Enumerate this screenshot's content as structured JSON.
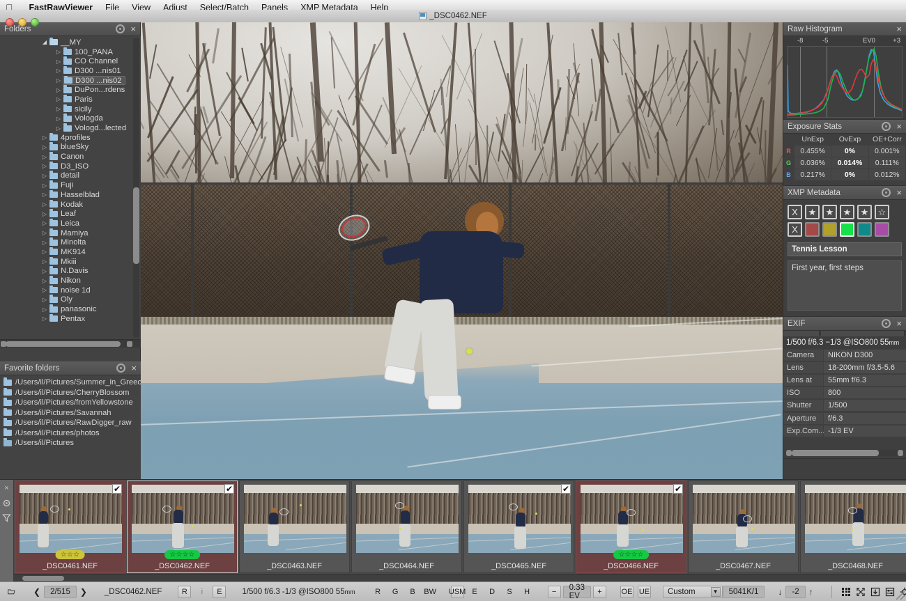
{
  "menubar": {
    "apple": "apple-logo",
    "items": [
      "FastRawViewer",
      "File",
      "View",
      "Adjust",
      "Select/Batch",
      "Panels",
      "XMP Metadata",
      "Help"
    ]
  },
  "window": {
    "title": "_DSC0462.NEF"
  },
  "folders_panel": {
    "title": "Folders",
    "tree": [
      {
        "label": "__MY",
        "depth": 1,
        "twisty": "open",
        "selected": false
      },
      {
        "label": "100_PANA",
        "depth": 2,
        "twisty": "closed",
        "selected": false
      },
      {
        "label": "CO Channel",
        "depth": 2,
        "twisty": "closed",
        "selected": false
      },
      {
        "label": "D300 ...nis01",
        "depth": 2,
        "twisty": "closed",
        "selected": false
      },
      {
        "label": "D300 ...nis02",
        "depth": 2,
        "twisty": "closed",
        "selected": true
      },
      {
        "label": "DuPon...rdens",
        "depth": 2,
        "twisty": "closed",
        "selected": false
      },
      {
        "label": "Paris",
        "depth": 2,
        "twisty": "closed",
        "selected": false
      },
      {
        "label": "sicily",
        "depth": 2,
        "twisty": "closed",
        "selected": false
      },
      {
        "label": "Vologda",
        "depth": 2,
        "twisty": "closed",
        "selected": false
      },
      {
        "label": "Vologd...lected",
        "depth": 2,
        "twisty": "closed",
        "selected": false
      },
      {
        "label": "4profiles",
        "depth": 1,
        "twisty": "closed",
        "selected": false
      },
      {
        "label": "blueSky",
        "depth": 1,
        "twisty": "closed",
        "selected": false
      },
      {
        "label": "Canon",
        "depth": 1,
        "twisty": "closed",
        "selected": false
      },
      {
        "label": "D3_ISO",
        "depth": 1,
        "twisty": "closed",
        "selected": false
      },
      {
        "label": "detail",
        "depth": 1,
        "twisty": "closed",
        "selected": false
      },
      {
        "label": "Fuji",
        "depth": 1,
        "twisty": "closed",
        "selected": false
      },
      {
        "label": "Hasselblad",
        "depth": 1,
        "twisty": "closed",
        "selected": false
      },
      {
        "label": "Kodak",
        "depth": 1,
        "twisty": "closed",
        "selected": false
      },
      {
        "label": "Leaf",
        "depth": 1,
        "twisty": "closed",
        "selected": false
      },
      {
        "label": "Leica",
        "depth": 1,
        "twisty": "closed",
        "selected": false
      },
      {
        "label": "Mamiya",
        "depth": 1,
        "twisty": "closed",
        "selected": false
      },
      {
        "label": "Minolta",
        "depth": 1,
        "twisty": "closed",
        "selected": false
      },
      {
        "label": "MK914",
        "depth": 1,
        "twisty": "closed",
        "selected": false
      },
      {
        "label": "Mkiii",
        "depth": 1,
        "twisty": "closed",
        "selected": false
      },
      {
        "label": "N.Davis",
        "depth": 1,
        "twisty": "closed",
        "selected": false
      },
      {
        "label": "Nikon",
        "depth": 1,
        "twisty": "closed",
        "selected": false
      },
      {
        "label": "noise 1d",
        "depth": 1,
        "twisty": "closed",
        "selected": false
      },
      {
        "label": "Oly",
        "depth": 1,
        "twisty": "closed",
        "selected": false
      },
      {
        "label": "panasonic",
        "depth": 1,
        "twisty": "closed",
        "selected": false
      },
      {
        "label": "Pentax",
        "depth": 1,
        "twisty": "closed",
        "selected": false
      }
    ]
  },
  "favorites_panel": {
    "title": "Favorite folders",
    "items": [
      "/Users/il/Pictures/Summer_in_Greece",
      "/Users/il/Pictures/CherryBlossom",
      "/Users/il/Pictures/fromYellowstone",
      "/Users/il/Pictures/Savannah",
      "/Users/il/Pictures/RawDigger_raw",
      "/Users/il/Pictures/photos",
      "/Users/il/Pictures"
    ]
  },
  "histogram_panel": {
    "title": "Raw Histogram",
    "axis_labels": [
      "-8",
      "-5",
      "EV0",
      "+3"
    ]
  },
  "exposure_stats": {
    "title": "Exposure Stats",
    "columns": [
      "UnExp",
      "OvExp",
      "OE+Corr"
    ],
    "rows": [
      {
        "channel": "R",
        "color": "#e05a5a",
        "unexp": "0.455%",
        "ovexp": "0%",
        "oecorr": "0.001%"
      },
      {
        "channel": "G",
        "color": "#5ad45a",
        "unexp": "0.036%",
        "ovexp": "0.014%",
        "oecorr": "0.111%"
      },
      {
        "channel": "B",
        "color": "#6aa8f0",
        "unexp": "0.217%",
        "ovexp": "0%",
        "oecorr": "0.012%"
      }
    ]
  },
  "xmp_panel": {
    "title": "XMP Metadata",
    "stars": [
      {
        "glyph": "X",
        "filled": false
      },
      {
        "glyph": "★",
        "filled": true
      },
      {
        "glyph": "★",
        "filled": true
      },
      {
        "glyph": "★",
        "filled": true
      },
      {
        "glyph": "★",
        "filled": true
      },
      {
        "glyph": "☆",
        "filled": false
      }
    ],
    "colors": [
      {
        "glyph": "X",
        "hex": "",
        "selected": false
      },
      {
        "glyph": "",
        "hex": "#a44848",
        "selected": false
      },
      {
        "glyph": "",
        "hex": "#b0a12c",
        "selected": false
      },
      {
        "glyph": "",
        "hex": "#16e04a",
        "selected": true
      },
      {
        "glyph": "",
        "hex": "#0f8a8a",
        "selected": false
      },
      {
        "glyph": "",
        "hex": "#a84ca8",
        "selected": false
      }
    ],
    "title_field": "Tennis Lesson",
    "description_field": "First year, first steps"
  },
  "exif_panel": {
    "title": "EXIF",
    "summary_main": "1/500 f/6.3 −1/3 @ISO800 55",
    "summary_unit": "mm",
    "rows": [
      {
        "key": "Camera",
        "value": "NIKON D300"
      },
      {
        "key": "Lens",
        "value": "18-200mm f/3.5-5.6"
      },
      {
        "key": "Lens at",
        "value": "55mm f/6.3"
      },
      {
        "key": "ISO",
        "value": "800"
      },
      {
        "key": "Shutter",
        "value": "1/500"
      },
      {
        "key": "Aperture",
        "value": "f/6.3"
      },
      {
        "key": "Exp.Com...",
        "value": "-1/3 EV"
      }
    ]
  },
  "filmstrip": {
    "tools": [
      "close-icon",
      "gear-icon",
      "filter-icon"
    ],
    "cells": [
      {
        "name": "_DSC0461.NEF",
        "marked": true,
        "current": false,
        "checked": true,
        "rating": {
          "stars": 3,
          "color": "#cdc43a",
          "text_color": "#3a3610"
        },
        "pose": 1
      },
      {
        "name": "_DSC0462.NEF",
        "marked": true,
        "current": true,
        "checked": true,
        "rating": {
          "stars": 4,
          "color": "#16c843",
          "text_color": "#0d3a14"
        },
        "pose": 2
      },
      {
        "name": "_DSC0463.NEF",
        "marked": false,
        "current": false,
        "checked": false,
        "rating": null,
        "pose": 3
      },
      {
        "name": "_DSC0464.NEF",
        "marked": false,
        "current": false,
        "checked": false,
        "rating": null,
        "pose": 4
      },
      {
        "name": "_DSC0465.NEF",
        "marked": false,
        "current": false,
        "checked": true,
        "rating": null,
        "pose": 5
      },
      {
        "name": "_DSC0466.NEF",
        "marked": true,
        "current": false,
        "checked": true,
        "rating": {
          "stars": 4,
          "color": "#16c843",
          "text_color": "#0d3a14"
        },
        "pose": 6
      },
      {
        "name": "_DSC0467.NEF",
        "marked": false,
        "current": false,
        "checked": false,
        "rating": null,
        "pose": 7
      },
      {
        "name": "_DSC0468.NEF",
        "marked": false,
        "current": false,
        "checked": false,
        "rating": null,
        "pose": 8
      }
    ]
  },
  "statusbar": {
    "folder_icon": "folder-open-icon",
    "prev_icon": "❮",
    "next_icon": "❯",
    "counter": "2/515",
    "filename": "_DSC0462.NEF",
    "mode_buttons": [
      "R",
      "i",
      "E"
    ],
    "exposure_text": "1/500 f/6.3 -1/3 @ISO800 55",
    "exposure_unit": "mm",
    "channel_buttons": [
      "R",
      "G",
      "B",
      "BW"
    ],
    "sharpen_buttons": [
      "USM",
      "E",
      "D",
      "S",
      "H"
    ],
    "ev_minus": "−",
    "ev_value": "0.33 EV",
    "ev_plus": "+",
    "oe_button": "OE",
    "ue_button": "UE",
    "wb_preset": "Custom",
    "temp_value": "5041K/1",
    "tint_down": "↓",
    "tint_value": "-2",
    "tint_up": "↑",
    "right_icons": [
      "grid-icon",
      "fit-screen-icon",
      "download-icon",
      "compare-icon",
      "target-icon"
    ]
  }
}
